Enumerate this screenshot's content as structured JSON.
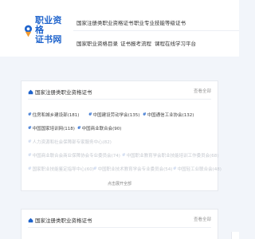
{
  "logo": {
    "line1": "职业资格",
    "line2": "证书网"
  },
  "nav": {
    "items": [
      "国家注册类职业资格证书",
      "职业专业技能等级证书",
      "国家职业资格目录",
      "证书报考流程",
      "课程在线学习平台"
    ]
  },
  "card1": {
    "title": "国家注册类职业资格证书",
    "more": "查看全部",
    "tags": [
      "住房和城乡建设部(181)",
      "中国建设劳动学会(135)",
      "中国通信工业协会(132)",
      "中国国家培训网(118)",
      "中国商业联合会(90)",
      "人力资源和社会保障部专家服务中心(82)",
      "中国商业联合会商业保障协会专业委员会(74)",
      "中国职业教育学会职业技能培训工作委员会(68)",
      "国家职业技能鉴定指导中心(60)",
      "中国职业技术教育学会专业委员会(54)",
      "中国轻工业联合会(48)"
    ],
    "expand": "点击展开全部"
  },
  "card2": {
    "title": "国家注册类职业资格证书",
    "more": "查看全部"
  },
  "colors": {
    "brand": "#1e63cc",
    "background": "#f2f5fa"
  }
}
